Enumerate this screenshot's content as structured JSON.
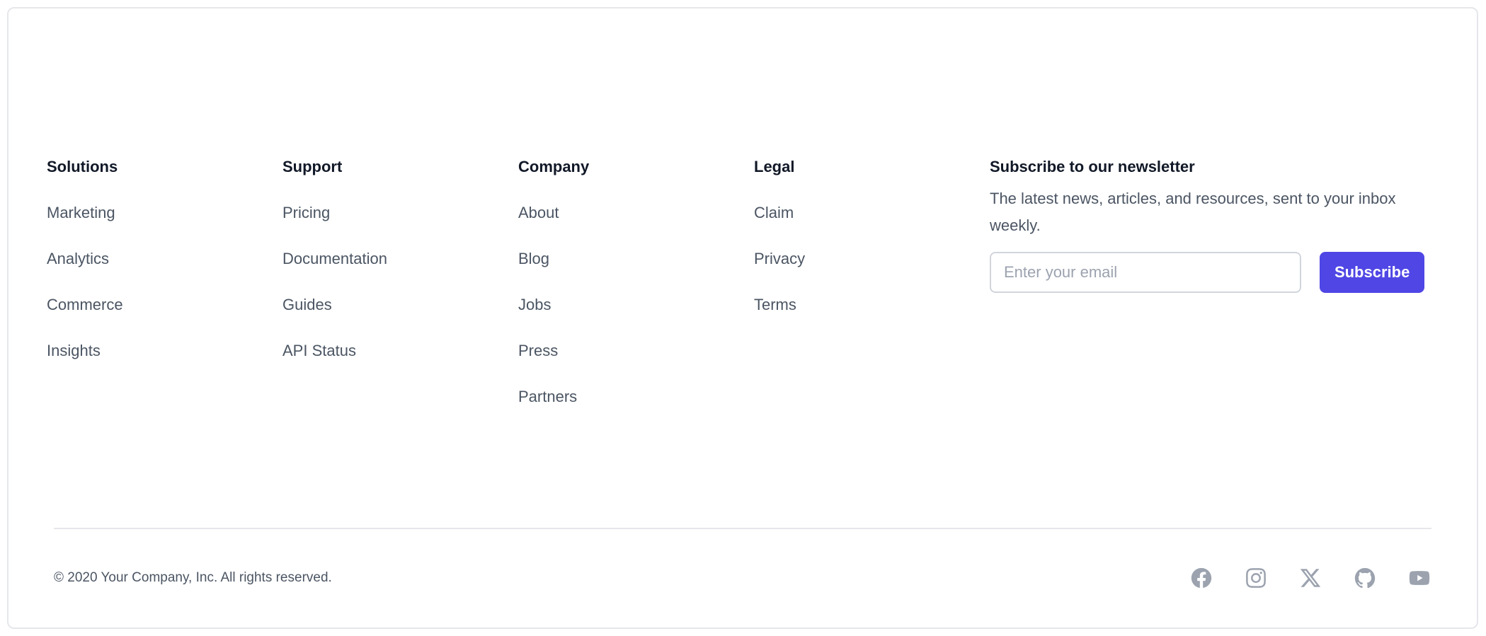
{
  "footer": {
    "columns": [
      {
        "heading": "Solutions",
        "links": [
          "Marketing",
          "Analytics",
          "Commerce",
          "Insights"
        ]
      },
      {
        "heading": "Support",
        "links": [
          "Pricing",
          "Documentation",
          "Guides",
          "API Status"
        ]
      },
      {
        "heading": "Company",
        "links": [
          "About",
          "Blog",
          "Jobs",
          "Press",
          "Partners"
        ]
      },
      {
        "heading": "Legal",
        "links": [
          "Claim",
          "Privacy",
          "Terms"
        ]
      }
    ],
    "newsletter": {
      "heading": "Subscribe to our newsletter",
      "description": "The latest news, articles, and resources, sent to your inbox weekly.",
      "email_placeholder": "Enter your email",
      "email_value": "",
      "button_label": "Subscribe"
    },
    "copyright": "© 2020 Your Company, Inc. All rights reserved.",
    "social_icons": [
      "facebook-icon",
      "instagram-icon",
      "x-icon",
      "github-icon",
      "youtube-icon"
    ]
  },
  "colors": {
    "accent": "#4f46e5",
    "heading": "#111827",
    "body_text": "#4b5563",
    "icon": "#9ca3af",
    "border": "#e5e7eb"
  }
}
